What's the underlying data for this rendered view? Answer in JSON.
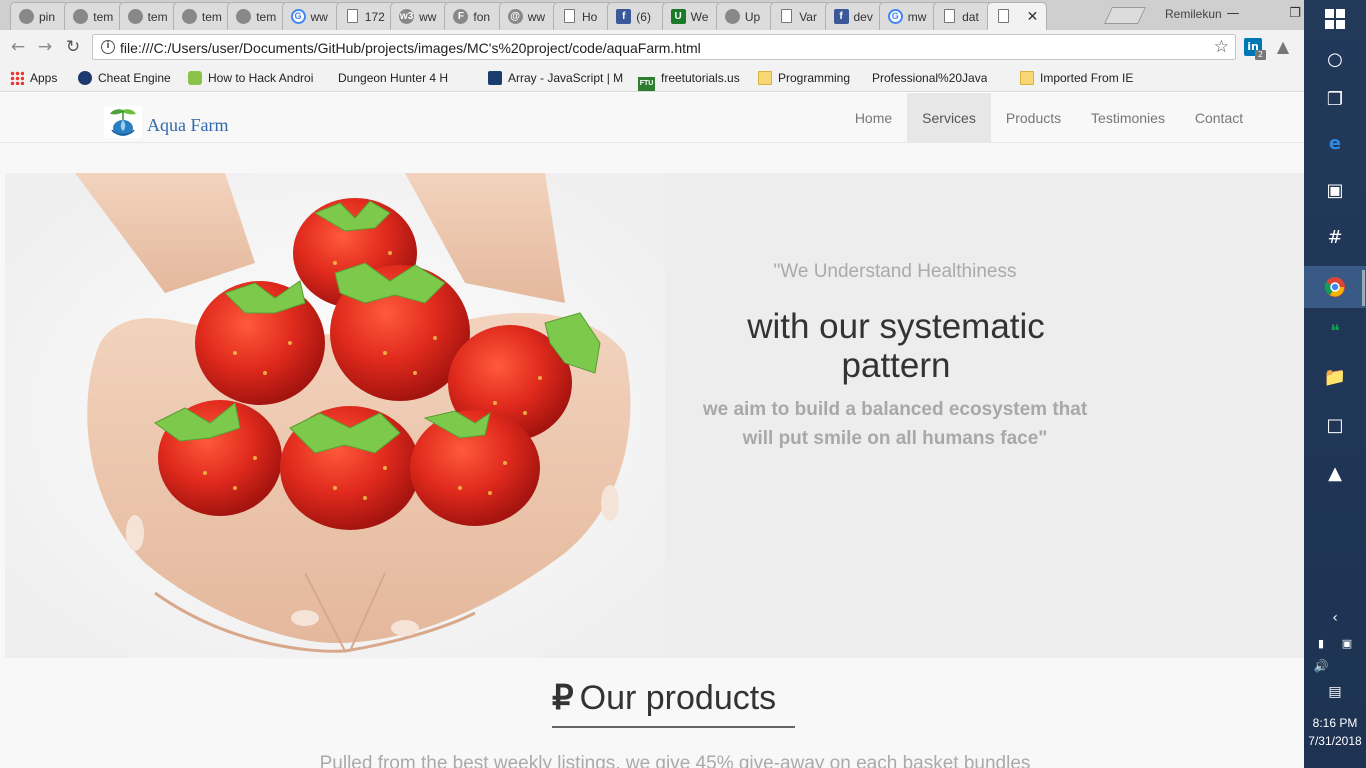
{
  "browser": {
    "tabs": [
      {
        "title": "pin",
        "icon": "github-icon"
      },
      {
        "title": "tem",
        "icon": "github-icon"
      },
      {
        "title": "tem",
        "icon": "github-icon"
      },
      {
        "title": "tem",
        "icon": "github-icon"
      },
      {
        "title": "tem",
        "icon": "github-icon"
      },
      {
        "title": "ww",
        "icon": "google-icon"
      },
      {
        "title": "172",
        "icon": "page-icon"
      },
      {
        "title": "ww",
        "icon": "w3-icon"
      },
      {
        "title": "fon",
        "icon": "f-icon"
      },
      {
        "title": "ww",
        "icon": "mail-icon"
      },
      {
        "title": "Ho",
        "icon": "page-icon"
      },
      {
        "title": "(6)",
        "icon": "facebook-icon"
      },
      {
        "title": "We",
        "icon": "upwork-icon"
      },
      {
        "title": "Up",
        "icon": "github-icon"
      },
      {
        "title": "Var",
        "icon": "page-icon"
      },
      {
        "title": "dev",
        "icon": "facebook-icon"
      },
      {
        "title": "mw",
        "icon": "google-icon"
      },
      {
        "title": "dat",
        "icon": "page-icon"
      },
      {
        "title": "",
        "icon": "page-icon",
        "active": true
      }
    ],
    "profile_name": "Remilekun",
    "url": "file:///C:/Users/user/Documents/GitHub/projects/images/MC's%20project/code/aquaFarm.html",
    "bookmarks": [
      {
        "label": "Apps",
        "icon": "apps-grid-icon"
      },
      {
        "label": "Cheat Engine",
        "icon": "cheat-engine-icon"
      },
      {
        "label": "How to Hack Androi",
        "icon": "android-icon"
      },
      {
        "label": "Dungeon Hunter 4 H",
        "icon": "page-icon"
      },
      {
        "label": "Array - JavaScript | M",
        "icon": "mdn-icon"
      },
      {
        "label": "freetutorials.us",
        "icon": "ftu-icon"
      },
      {
        "label": "Programming",
        "icon": "folder-icon"
      },
      {
        "label": "Professional%20Java",
        "icon": "page-icon"
      },
      {
        "label": "Imported From IE",
        "icon": "folder-icon"
      }
    ],
    "extension_badge": "2"
  },
  "site": {
    "brand": "Aqua Farm",
    "nav": [
      "Home",
      "Services",
      "Products",
      "Testimonies",
      "Contact"
    ],
    "active_nav": "Services",
    "hero": {
      "quote": "\"We Understand Healthiness",
      "heading": "with our systematic pattern",
      "sub": "we aim to build a balanced ecosystem that will put smile on all humans face\""
    },
    "products": {
      "symbol": "₽",
      "title": "Our products",
      "description": "Pulled from the best weekly listings, we give 45% give-away on each basket bundles"
    }
  },
  "taskbar": {
    "time": "8:16 PM",
    "date": "7/31/2018"
  },
  "colors": {
    "brand_blue": "#2f6aa8",
    "taskbar_bg": "#1e3352",
    "strawberry_red": "#d9261c"
  }
}
